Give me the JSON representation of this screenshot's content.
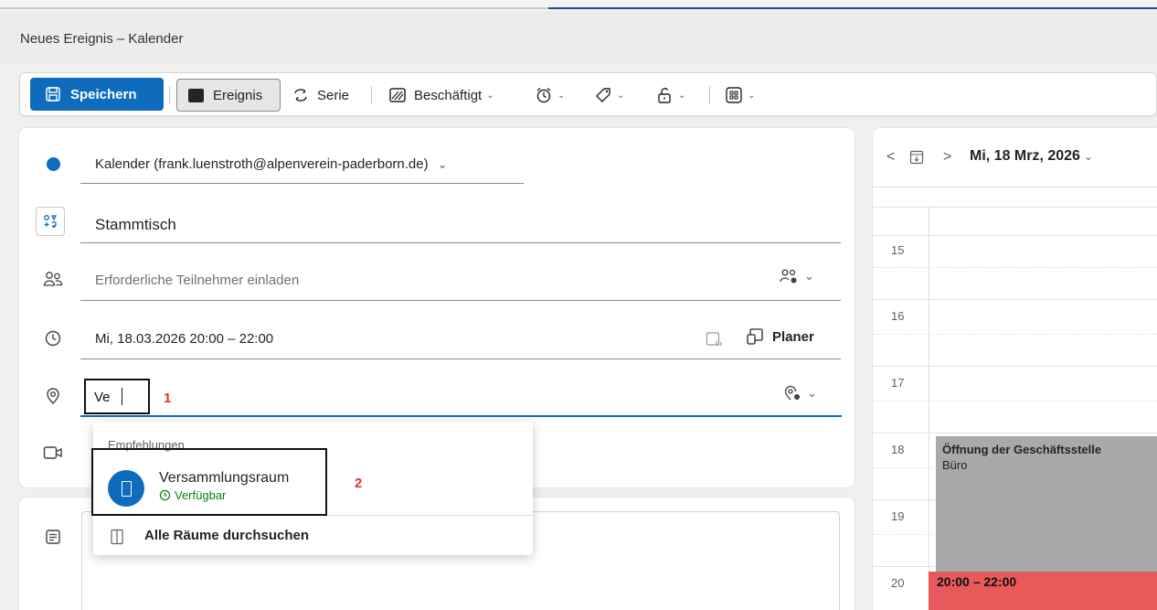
{
  "window": {
    "title": "Neues Ereignis – Kalender"
  },
  "toolbar": {
    "save_label": "Speichern",
    "event_label": "Ereignis",
    "series_label": "Serie",
    "busy_label": "Beschäftigt"
  },
  "form": {
    "calendar": "Kalender (frank.luenstroth@alpenverein-paderborn.de)",
    "title": "Stammtisch",
    "attendees_placeholder": "Erforderliche Teilnehmer einladen",
    "datetime": "Mi, 18.03.2026 20:00 – 22:00",
    "scheduler_label": "Planer",
    "location_value": "Ve",
    "accent_color": "#0f6cbd"
  },
  "annotations": {
    "marker1": "1",
    "marker2": "2",
    "marker_color": "#e8322b"
  },
  "suggestions": {
    "header": "Empfehlungen",
    "room_name": "Versammlungsraum",
    "room_status": "Verfügbar",
    "search_all": "Alle Räume durchsuchen"
  },
  "calendar_view": {
    "date": "Mi, 18 Mrz, 2026",
    "hours": [
      "15",
      "16",
      "17",
      "18",
      "19",
      "20"
    ],
    "events": [
      {
        "title": "Öffnung der Geschäftsstelle",
        "location": "Büro",
        "color": "#a9a9a9"
      },
      {
        "title": "20:00 – 22:00",
        "color": "#e8595c"
      }
    ]
  }
}
